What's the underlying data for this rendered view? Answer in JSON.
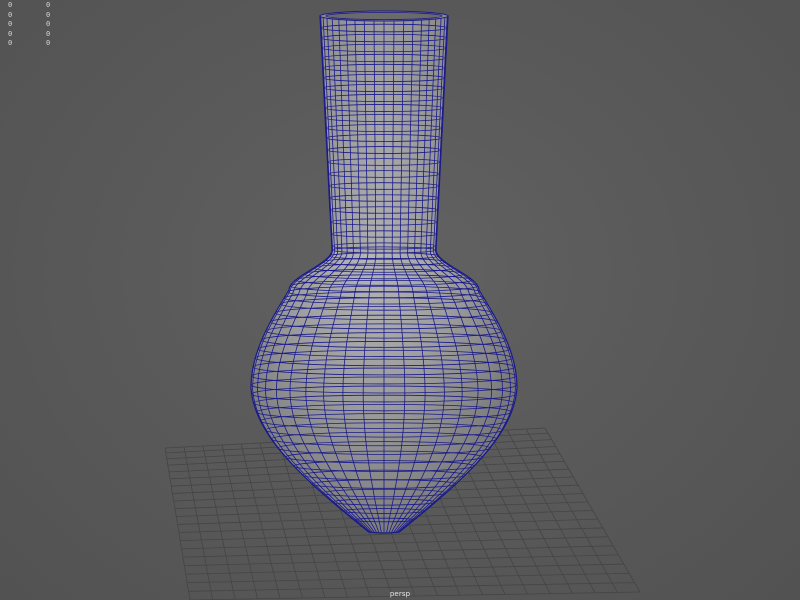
{
  "viewport": {
    "camera_name": "persp",
    "background_color": "#555555",
    "grid_color": "#454545",
    "wireframe_color": "#1a1a8a"
  },
  "hud": {
    "rows": [
      {
        "label": "0",
        "value": "0"
      },
      {
        "label": "0",
        "value": "0"
      },
      {
        "label": "0",
        "value": "0"
      },
      {
        "label": "0",
        "value": "0"
      },
      {
        "label": "0",
        "value": "0"
      }
    ]
  },
  "model": {
    "name": "vase",
    "display": "wireframe-on-shaded"
  }
}
